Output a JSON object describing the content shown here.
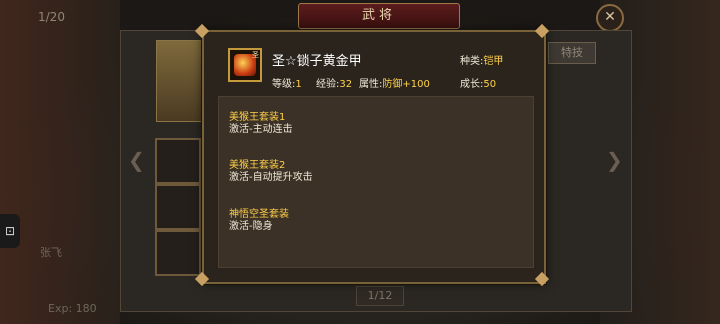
{
  "background": {
    "page_count": "1/20",
    "title": "武将",
    "side_button": "特技",
    "page_indicator": "1/12",
    "hero_name_partial": "张飞",
    "exp_partial": "Exp: 180"
  },
  "tooltip": {
    "item_icon_tag": "圣",
    "item_name": "圣☆锁子黄金甲",
    "type_label": "种类:",
    "type_value": "铠甲",
    "level_label": "等级:",
    "level_value": "1",
    "exp_label": "经验:",
    "exp_value": "32",
    "attr_label": "属性:",
    "attr_value": "防御+100",
    "growth_label": "成长:",
    "growth_value": "50",
    "sets": [
      {
        "title": "美猴王套装1",
        "desc": "激活-主动连击"
      },
      {
        "title": "美猴王套装2",
        "desc": "激活-自动提升攻击"
      },
      {
        "title": "神悟空圣套装",
        "desc": "激活-隐身"
      }
    ]
  },
  "colors": {
    "highlight": "#ffd24a",
    "frame": "#7a6238"
  }
}
